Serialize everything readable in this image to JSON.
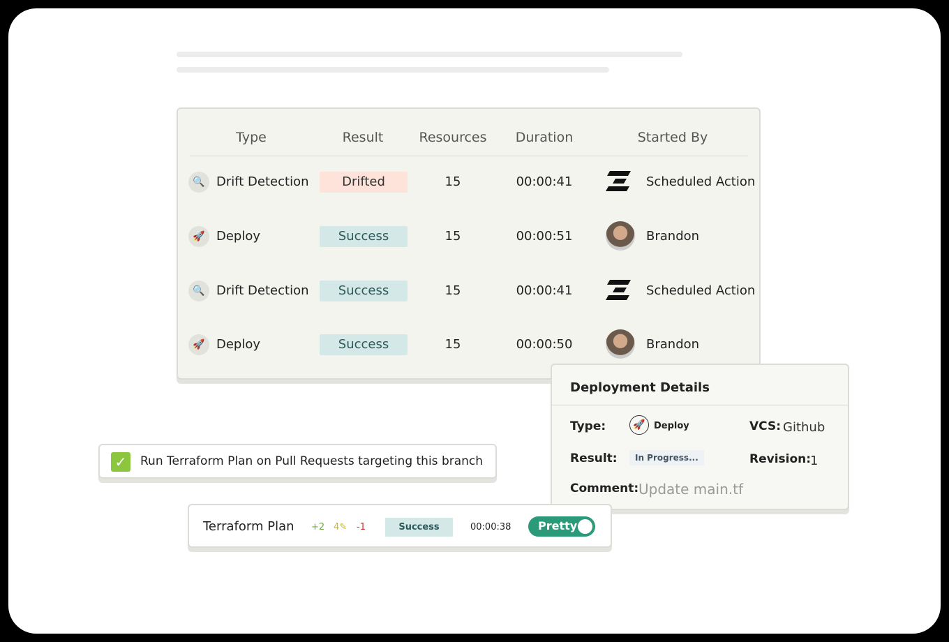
{
  "table": {
    "headers": [
      "Type",
      "Result",
      "Resources",
      "Duration",
      "Started By"
    ],
    "rows": [
      {
        "type": "Drift Detection",
        "type_icon": "drift-detection-icon",
        "result": "Drifted",
        "resources": "15",
        "duration": "00:00:41",
        "started_by": "Scheduled Action",
        "starter_icon": "env0-logo"
      },
      {
        "type": "Deploy",
        "type_icon": "rocket-icon",
        "result": "Success",
        "resources": "15",
        "duration": "00:00:51",
        "started_by": "Brandon",
        "starter_icon": "avatar"
      },
      {
        "type": "Drift Detection",
        "type_icon": "drift-detection-icon",
        "result": "Success",
        "resources": "15",
        "duration": "00:00:41",
        "started_by": "Scheduled Action",
        "starter_icon": "env0-logo"
      },
      {
        "type": "Deploy",
        "type_icon": "rocket-icon",
        "result": "Success",
        "resources": "15",
        "duration": "00:00:50",
        "started_by": "Brandon",
        "starter_icon": "avatar"
      }
    ]
  },
  "details": {
    "title": "Deployment Details",
    "type_label": "Type:",
    "type_value": "Deploy",
    "vcs_label": "VCS:",
    "vcs_value": "Github",
    "result_label": "Result:",
    "result_value": "In Progress...",
    "revision_label": "Revision:",
    "revision_value": "1",
    "comment_label": "Comment:",
    "comment_value": "Update main.tf"
  },
  "checkbox": {
    "label": "Run Terraform Plan on Pull Requests targeting this branch",
    "checked": true
  },
  "plan": {
    "title": "Terraform Plan",
    "added": "+2",
    "changed": "4",
    "removed": "-1",
    "result": "Success",
    "duration": "00:00:38",
    "toggle_label": "Pretty",
    "toggle_on": true
  },
  "colors": {
    "drifted": "#fde3d9",
    "success": "#d5e8e8",
    "accent": "#2a9a78",
    "check": "#8cc63f"
  }
}
